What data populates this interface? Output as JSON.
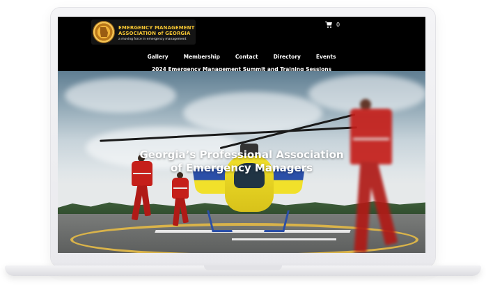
{
  "logo": {
    "line1": "EMERGENCY MANAGEMENT",
    "line2": "ASSOCIATION of GEORGIA",
    "tagline": "a moving force in emergency management"
  },
  "cart": {
    "count": "0",
    "icon": "shopping-cart-icon"
  },
  "nav": {
    "items": [
      {
        "label": "Gallery"
      },
      {
        "label": "Membership"
      },
      {
        "label": "Contact"
      },
      {
        "label": "Directory"
      },
      {
        "label": "Events"
      }
    ],
    "secondary": "2024 Emergency Management Summit and Training Sessions"
  },
  "hero": {
    "title_line1": "Georgia’s Professional Association",
    "title_line2": "of Emergency Managers"
  },
  "colors": {
    "header_bg": "#000000",
    "logo_gold": "#f1c232",
    "nav_text": "#ffffff",
    "helicopter_yellow": "#f1e02a",
    "responder_red": "#c51f1a"
  }
}
